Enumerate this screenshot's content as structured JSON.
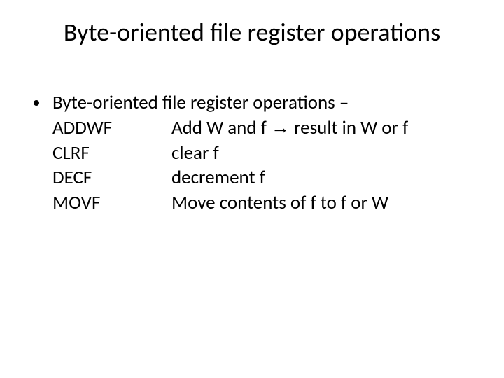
{
  "title": "Byte-oriented file register operations",
  "intro": "Byte-oriented file register operations –",
  "ops": [
    {
      "mnemonic": "ADDWF",
      "desc_pre": "Add W and f ",
      "arrow": "→",
      "desc_post": " result in W or f"
    },
    {
      "mnemonic": "CLRF",
      "desc_pre": "clear f",
      "arrow": "",
      "desc_post": ""
    },
    {
      "mnemonic": "DECF",
      "desc_pre": "decrement f",
      "arrow": "",
      "desc_post": ""
    },
    {
      "mnemonic": "MOVF",
      "desc_pre": "Move contents of f to f or W",
      "arrow": "",
      "desc_post": ""
    }
  ]
}
